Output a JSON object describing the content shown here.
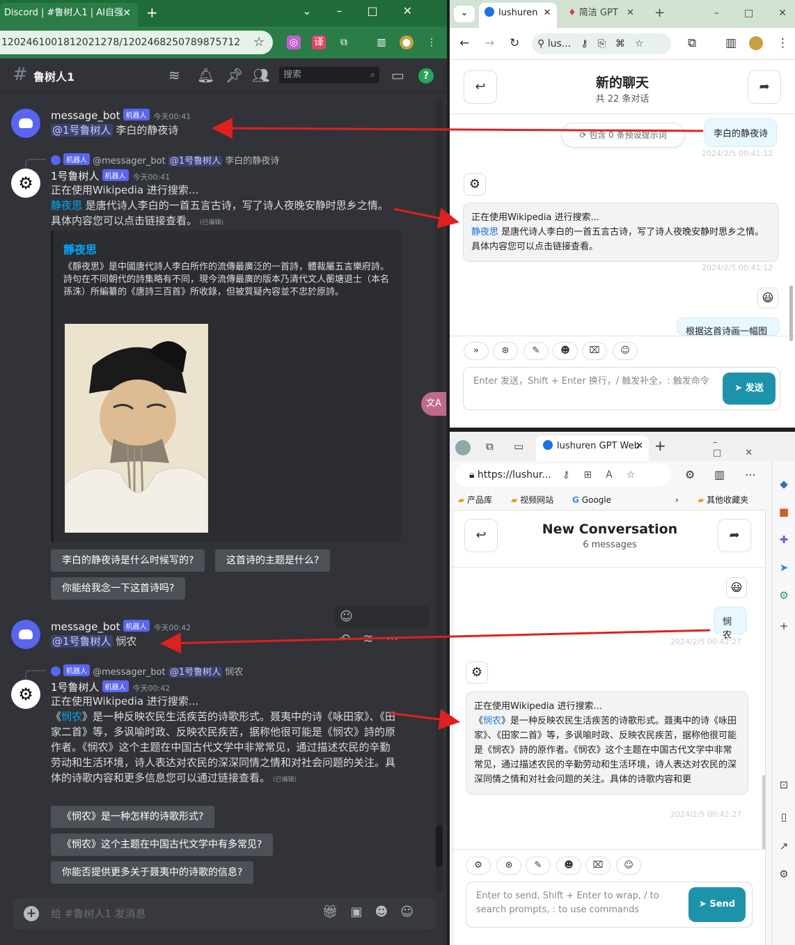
{
  "left": {
    "tab_title": "Discord | #鲁树人1 | AI自强",
    "url": "1202461001812021278/1202468250789875712",
    "channel": "鲁树人1",
    "search_placeholder": "搜索",
    "bot_badge": "机器人",
    "messages": [
      {
        "author": "message_bot",
        "time": "今天00:41",
        "mention": "@1号鲁树人",
        "text": "李白的静夜诗"
      },
      {
        "reply_author": "@messager_bot",
        "reply_mention": "@1号鲁树人",
        "reply_text": "李白的静夜诗",
        "author": "1号鲁树人",
        "time": "今天00:41",
        "line1": "正在使用Wikipedia 进行搜索...",
        "link": "静夜思",
        "body": " 是唐代诗人李白的一首五言古诗，写了诗人夜晚安静时思乡之情。具体内容您可以点击链接查看。",
        "edited": "(已编辑)"
      },
      {
        "author": "message_bot",
        "time": "今天00:42",
        "mention": "@1号鲁树人",
        "text": "悯农"
      },
      {
        "reply_author": "@messager_bot",
        "reply_mention": "@1号鲁树人",
        "reply_text": "悯农",
        "author": "1号鲁树人",
        "time": "今天00:42",
        "line1": "正在使用Wikipedia 进行搜索...",
        "pre": "《",
        "link": "悯农",
        "body": "》是一种反映农民生活疾苦的诗歌形式。聂夷中的诗《咏田家》、《田家二首》等，多讽喻时政、反映农民疾苦，据称他很可能是《悯农》詩的原作者。《悯农》这个主题在中国古代文学中非常常见，通过描述农民的辛勤劳动和生活环境，诗人表达对农民的深深同情之情和对社会问题的关注。具体的诗歌内容和更多信息您可以通过链接查看。",
        "edited": "(已编辑)"
      }
    ],
    "embed": {
      "title": "靜夜思",
      "desc": "《靜夜思》是中國唐代詩人李白所作的流傳最廣泛的一首詩，體裁屬五言樂府詩。詩句在不同朝代的詩集略有不同，現今流傳最廣的版本乃清代文人蘅塘退士（本名孫洙）所編纂的《唐詩三百首》所收錄，但被質疑內容並不忠於原詩。"
    },
    "suggestions1": [
      "李白的静夜诗是什么时候写的?",
      "这首诗的主题是什么?",
      "你能给我念一下这首诗吗?"
    ],
    "suggestions2": [
      "《悯农》是一种怎样的诗歌形式?",
      "《悯农》这个主题在中国古代文学中有多常见?",
      "你能否提供更多关于聂夷中的诗歌的信息?"
    ],
    "input_placeholder": "给 #鲁树人1 发消息"
  },
  "right_top": {
    "tab1": "lushuren",
    "tab2": "简洁 GPT",
    "url": "lus...",
    "title": "新的聊天",
    "subtitle": "共 22 条对话",
    "pill": "包含 0 条预设提示词",
    "user_msg": "李白的静夜诗",
    "user_ts": "2024/2/5 00:41:12",
    "bot_line1": "正在使用Wikipedia 进行搜索...",
    "bot_link": "静夜思",
    "bot_body": " 是唐代诗人李白的一首五言古诗，写了诗人夜晚安静时思乡之情。具体内容您可以点击链接查看。",
    "bot_ts": "2024/2/5 00:41:12",
    "next_msg": "根据这首诗画一幅图",
    "input_placeholder": "Enter 发送，Shift + Enter 换行，/ 触发补全，: 触发命令",
    "send": "发送"
  },
  "right_bottom": {
    "tab": "lushuren GPT Web",
    "url": "https://lushur...",
    "favorites": [
      "产品库",
      "视频网站",
      "Google",
      "其他收藏夹"
    ],
    "title": "New Conversation",
    "subtitle": "6 messages",
    "user_msg": "悯农",
    "user_ts": "2024/2/5 00:42:27",
    "bot_line1": "正在使用Wikipedia 进行搜索...",
    "bot_pre": "《",
    "bot_link": "悯农",
    "bot_body": "》是一种反映农民生活疾苦的诗歌形式。聂夷中的诗《咏田家》、《田家二首》等，多讽喻时政、反映农民疾苦，据称他很可能是《悯农》詩的原作者。《悯农》这个主题在中国古代文学中非常常见，通过描述农民的辛勤劳动和生活环境，诗人表达对农民的深深同情之情和对社会问题的关注。具体的诗歌内容和更",
    "bot_ts": "2024/2/5 00:42:27",
    "input_placeholder": "Enter to send, Shift + Enter to wrap, / to search prompts, : to use commands",
    "send": "Send"
  },
  "colors": {
    "discord_bg": "#313338",
    "accent_blue": "#5865f2",
    "send_teal": "#1d93ab",
    "arrow_red": "#e02020"
  }
}
